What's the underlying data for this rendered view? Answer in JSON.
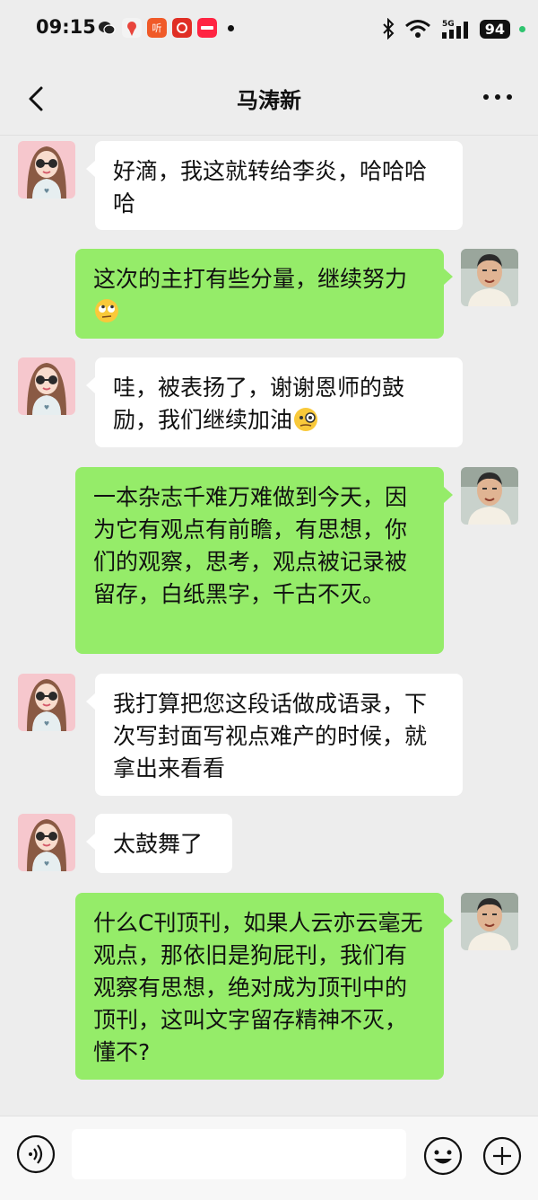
{
  "status_bar": {
    "time": "09:15",
    "battery": "94",
    "network": "5G"
  },
  "header": {
    "title": "马涛新"
  },
  "messages": [
    {
      "side": "left",
      "text": "好滴，我这就转给李炎，哈哈哈哈"
    },
    {
      "side": "right",
      "text": "这次的主打有些分量，继续努力",
      "emoji": "eye-roll-emoji"
    },
    {
      "side": "left",
      "text": "哇，被表扬了，谢谢恩师的鼓励，我们继续加油",
      "emoji": "monocle-face-emoji"
    },
    {
      "side": "right",
      "text": "一本杂志千难万难做到今天，因为它有观点有前瞻，有思想，你们的观察，思考，观点被记录被留存，白纸黑字，千古不灭。"
    },
    {
      "side": "left",
      "text": "我打算把您这段话做成语录，下次写封面写视点难产的时候，就拿出来看看"
    },
    {
      "side": "left",
      "text": "太鼓舞了"
    },
    {
      "side": "right",
      "text": "什么C刊顶刊，如果人云亦云毫无观点，那依旧是狗屁刊，我们有观察有思想，绝对成为顶刊中的顶刊，这叫文字留存精神不灭，懂不?"
    }
  ],
  "colors": {
    "background": "#ededed",
    "sent_bubble": "#95ec69",
    "received_bubble": "#ffffff"
  }
}
